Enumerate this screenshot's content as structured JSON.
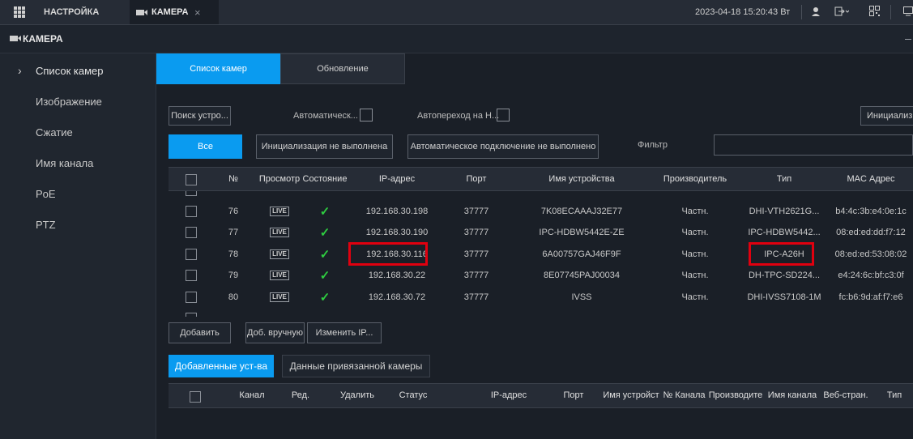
{
  "topbar": {
    "settings_tab": "НАСТРОЙКА",
    "camera_tab": "КАМЕРА",
    "close_glyph": "×",
    "datetime": "2023-04-18 15:20:43 Вт"
  },
  "title": "КАМЕРА",
  "sidebar": {
    "items": [
      {
        "label": "Список камер",
        "active": true
      },
      {
        "label": "Изображение"
      },
      {
        "label": "Сжатие"
      },
      {
        "label": "Имя канала"
      },
      {
        "label": "PoE"
      },
      {
        "label": "PTZ"
      }
    ]
  },
  "tabs": {
    "list": "Список камер",
    "update": "Обновление"
  },
  "search": {
    "search_button": "Поиск устро...",
    "auto_label": "Автоматическ...",
    "autojump_label": "Автопереход на Н...",
    "init_button": "Инициализи"
  },
  "filters": {
    "all": "Все",
    "not_initialized": "Инициализация не выполнена",
    "auto_connect_failed": "Автоматическое подключение не выполнено",
    "filter_label": "Фильтр",
    "filter_value": ""
  },
  "device_table": {
    "columns": [
      "№",
      "Просмотр",
      "Состояние",
      "IP-адрес",
      "Порт",
      "Имя устройства",
      "Производитель",
      "Тип",
      "MAC Адрес"
    ],
    "rows": [
      {
        "no": "76",
        "ip": "192.168.30.198",
        "port": "37777",
        "name": "7K08ECAAAJ32E77",
        "vendor": "Частн.",
        "type": "DHI-VTH2621G...",
        "mac": "b4:4c:3b:e4:0e:1c"
      },
      {
        "no": "77",
        "ip": "192.168.30.190",
        "port": "37777",
        "name": "IPC-HDBW5442E-ZE",
        "vendor": "Частн.",
        "type": "IPC-HDBW5442...",
        "mac": "08:ed:ed:dd:f7:12"
      },
      {
        "no": "78",
        "ip": "192.168.30.116",
        "port": "37777",
        "name": "6A00757GAJ46F9F",
        "vendor": "Частн.",
        "type": "IPC-A26H",
        "mac": "08:ed:ed:53:08:02"
      },
      {
        "no": "79",
        "ip": "192.168.30.22",
        "port": "37777",
        "name": "8E07745PAJ00034",
        "vendor": "Частн.",
        "type": "DH-TPC-SD224...",
        "mac": "e4:24:6c:bf:c3:0f"
      },
      {
        "no": "80",
        "ip": "192.168.30.72",
        "port": "37777",
        "name": "IVSS",
        "vendor": "Частн.",
        "type": "DHI-IVSS7108-1M",
        "mac": "fc:b6:9d:af:f7:e6"
      }
    ],
    "live_label": "LIVE",
    "ok_glyph": "✓"
  },
  "actions": {
    "add": "Добавить",
    "add_manual": "Доб. вручную",
    "change_ip": "Изменить IP..."
  },
  "bottom_tabs": {
    "added": "Добавленные уст-ва",
    "bound": "Данные привязанной камеры"
  },
  "added_table": {
    "columns": [
      "Канал",
      "Ред.",
      "Удалить",
      "Статус",
      "IP-адрес",
      "Порт",
      "Имя устройст",
      "№ Канала",
      "Производите",
      "Имя канала",
      "Веб-стран.",
      "Тип"
    ]
  },
  "colors": {
    "accent": "#0a9bf0",
    "highlight": "#e0000f",
    "ok": "#2ecc40"
  }
}
